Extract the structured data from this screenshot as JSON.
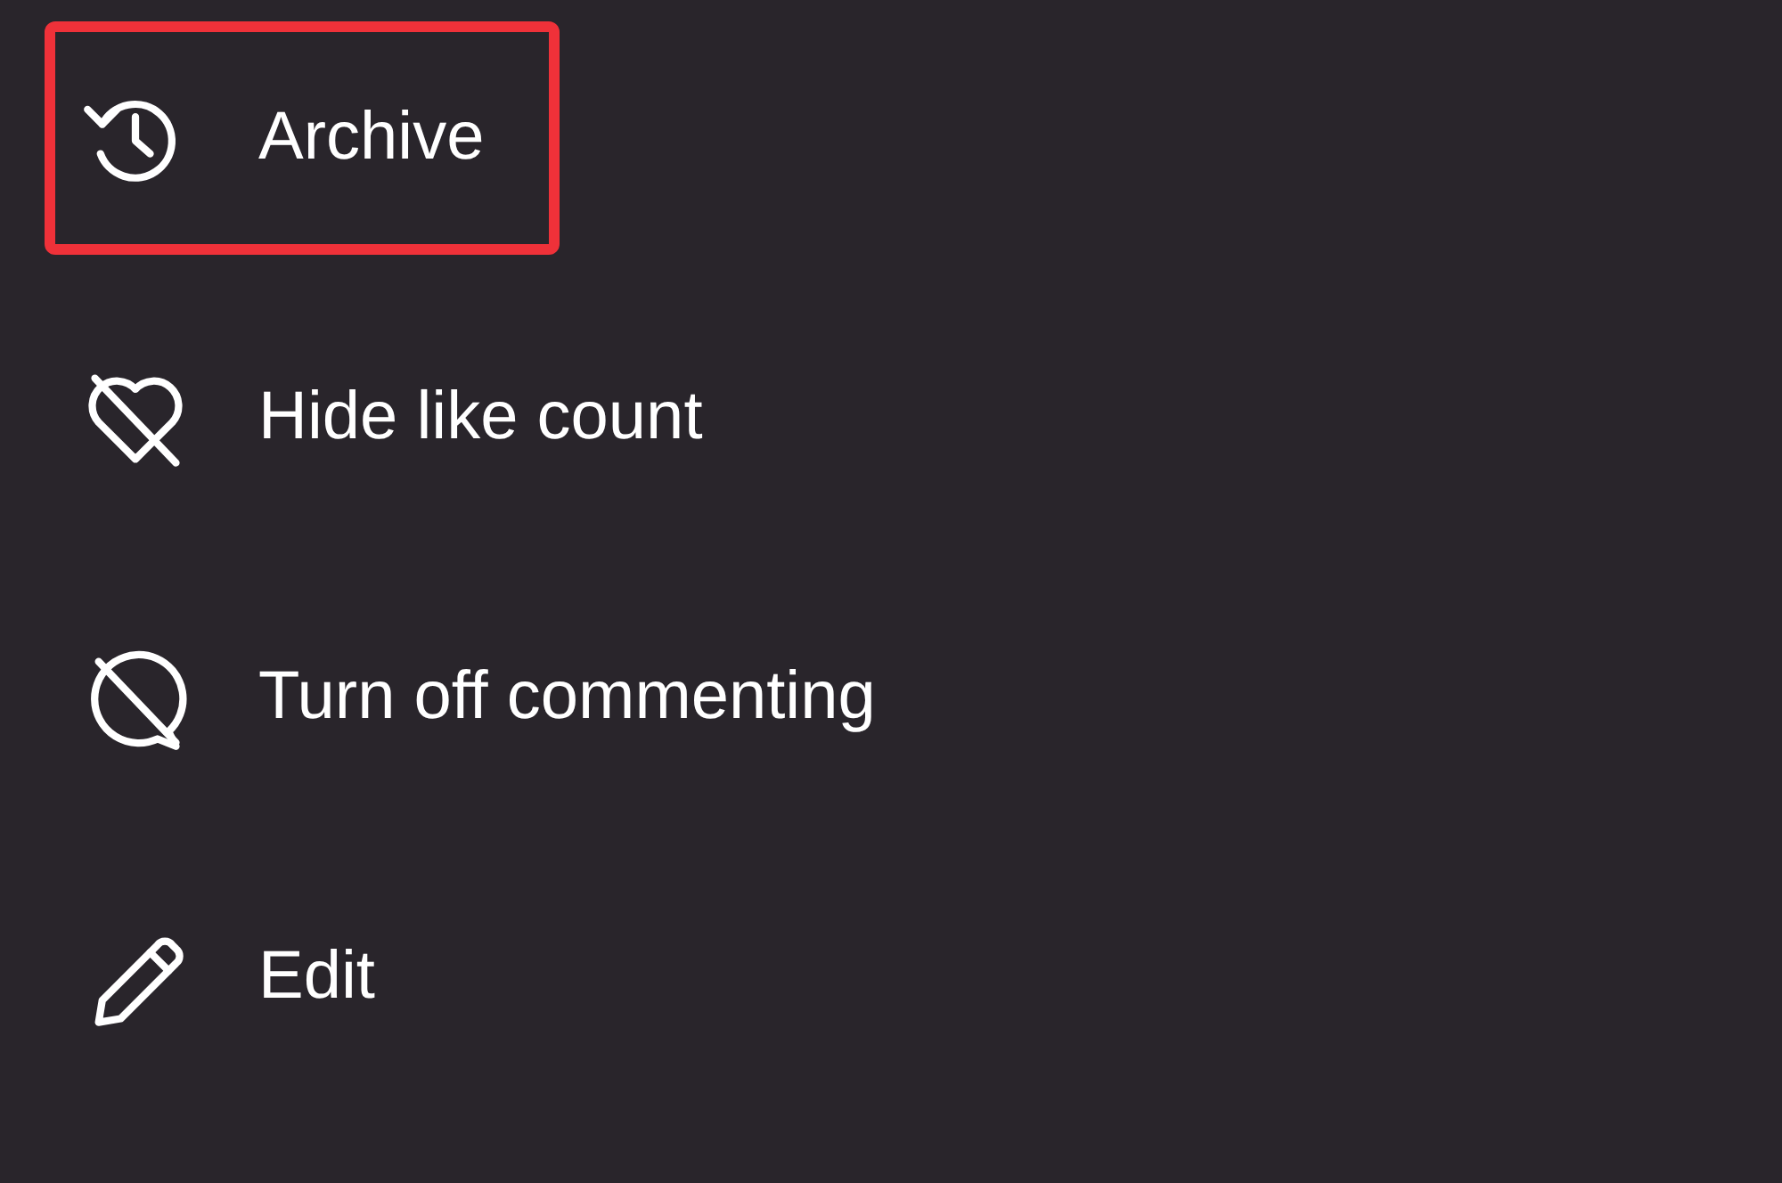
{
  "menu": {
    "items": [
      {
        "kind": "archive",
        "label": "Archive",
        "highlighted": true
      },
      {
        "kind": "likes",
        "label": "Hide like count",
        "highlighted": false
      },
      {
        "kind": "comments",
        "label": "Turn off commenting",
        "highlighted": false
      },
      {
        "kind": "edit",
        "label": "Edit",
        "highlighted": false
      }
    ]
  }
}
